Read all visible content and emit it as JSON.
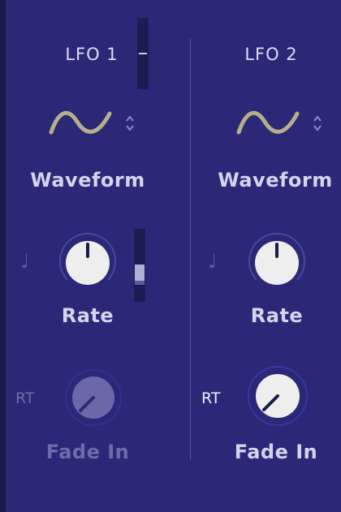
{
  "lfo1": {
    "title": "LFO 1",
    "waveform_label": "Waveform",
    "rate_label": "Rate",
    "fade_label": "Fade In",
    "rt_label": "RT",
    "rate_sync_glyph": "♩",
    "fade_enabled": false
  },
  "lfo2": {
    "title": "LFO 2",
    "waveform_label": "Waveform",
    "rate_label": "Rate",
    "fade_label": "Fade In",
    "rt_label": "RT",
    "rate_sync_glyph": "♩",
    "fade_enabled": true
  },
  "icons": {
    "waveform": "sine-wave-icon",
    "selector": "up-down-arrows-icon",
    "sync": "quarter-note-icon"
  },
  "colors": {
    "panel": "#2b2878",
    "background": "#1b1a4c",
    "knob": "#eeeeee",
    "wave": "#b5b08a"
  }
}
